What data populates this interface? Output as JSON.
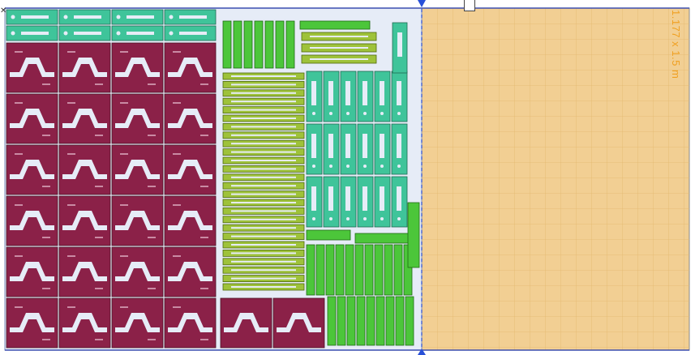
{
  "sheet": {
    "size_label": "1.177 x 1.5 m",
    "material_color": "#f2cf93",
    "grid_color": "#e3b86e",
    "nest_area_color": "#e6ecf7"
  },
  "parts": {
    "teal": {
      "name": "bracket-part",
      "fill": "#3fc49a",
      "stroke": "#1e6b52"
    },
    "maroon": {
      "name": "panel-part",
      "fill": "#8b2148",
      "stroke": "#4a0f24"
    },
    "olive": {
      "name": "slotted-rail-part",
      "fill": "#9ec23a",
      "stroke": "#4f6a10"
    },
    "green": {
      "name": "clip-part",
      "fill": "#4cc63a",
      "stroke": "#1f6a14"
    }
  },
  "markers": {
    "corner_glyph": "✕",
    "divider_color": "#2850d8"
  }
}
